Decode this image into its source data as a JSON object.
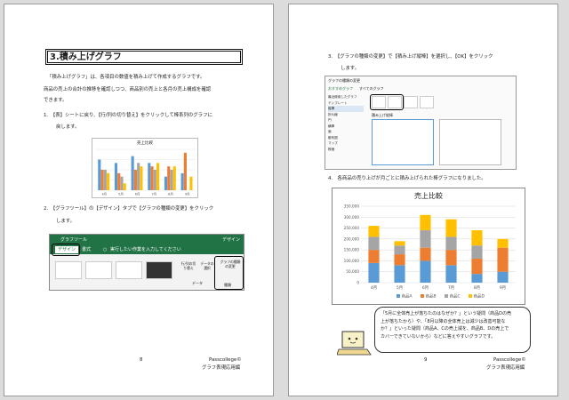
{
  "page_left": {
    "title": "3.積み上げグラフ",
    "intro1": "「積み上げグラフ」は、各項目の数値を積み上げて作成するグラフです。",
    "intro2": "商品の売上の合計の推移を確認しつつ、商品別の売上と各月の売上構成を確認",
    "intro3": "できます。",
    "step1_line1": "1.　【表】シートに戻り、【行/列の切り替え】をクリックして棒系列のグラフに",
    "step1_line2": "戻します。",
    "small_chart_title": "売上比較",
    "step2_line1": "2.　【グラフツール】の【デザイン】タブで【グラフの種類の変更】をクリック",
    "step2_line2": "します。",
    "ribbon": {
      "tools_label": "グラフツール",
      "design_label": "デザイン",
      "tab_design": "デザイン",
      "tab_format": "書式",
      "tell_me": "実行したい作業を入力してください",
      "switch_btn": "行/列の切り替え",
      "select_data_btn": "データの選択",
      "group_data": "データ",
      "change_type_btn": "グラフの種類の変更",
      "group_type": "種類"
    },
    "page_number": "8",
    "publisher": "Passcollege©",
    "book": "グラフ表現応用編"
  },
  "page_right": {
    "step3_line1": "3.　【グラフの種類の変更】で【積み上げ縦棒】を選択し、【OK】をクリック",
    "step3_line2": "します。",
    "dialog": {
      "title": "グラフの種類の変更",
      "tab_recommended": "おすすめグラフ",
      "tab_all": "すべてのグラフ",
      "left_items": [
        "最近使用したグラフ",
        "テンプレート",
        "縦棒",
        "折れ線",
        "円",
        "横棒",
        "面",
        "散布図",
        "マップ",
        "株価"
      ],
      "selected_heading": "積み上げ縦棒"
    },
    "step4_line1": "4.　各商品の売り上げが月ごとに積み上げられた棒グラフになりました。",
    "chart_data": {
      "type": "bar",
      "title": "売上比較",
      "categories": [
        "4月",
        "5月",
        "6月",
        "7月",
        "8月",
        "9月"
      ],
      "series": [
        {
          "name": "商品A",
          "color": "#5b9bd5",
          "values": [
            90000,
            80000,
            100000,
            80000,
            40000,
            50000
          ]
        },
        {
          "name": "商品B",
          "color": "#ed7d31",
          "values": [
            60000,
            50000,
            60000,
            70000,
            70000,
            110000
          ]
        },
        {
          "name": "商品C",
          "color": "#a5a5a5",
          "values": [
            60000,
            40000,
            80000,
            60000,
            60000,
            0
          ]
        },
        {
          "name": "商品D",
          "color": "#ffc000",
          "values": [
            50000,
            20000,
            70000,
            80000,
            70000,
            40000
          ]
        }
      ],
      "ylim": [
        0,
        350000
      ],
      "yticks": [
        "0",
        "50,000",
        "100,000",
        "150,000",
        "200,000",
        "250,000",
        "300,000",
        "350,000"
      ],
      "legend": "bottom",
      "grid": true
    },
    "bubble": {
      "line1": "「5月に全体売上が落ちたのはなぜか？」という疑問（商品Dの売",
      "line2": "上が落ちたから）や、「8月以降の全体売上は減少は改善可能な",
      "line3": "か？」といった疑問（商品A、Cの売上減を、商品B、Dの売上で",
      "line4": "カバーできていないから）などに答えやすいグラフです。"
    },
    "page_number": "9",
    "publisher": "Passcollege©",
    "book": "グラフ表現応用編"
  },
  "small_chart": {
    "categories": [
      "4月",
      "5月",
      "6月",
      "7月",
      "8月",
      "9月"
    ],
    "series": [
      {
        "color": "#5b9bd5",
        "values": [
          90000,
          80000,
          100000,
          80000,
          40000,
          50000
        ]
      },
      {
        "color": "#ed7d31",
        "values": [
          60000,
          50000,
          60000,
          70000,
          70000,
          110000
        ]
      },
      {
        "color": "#a5a5a5",
        "values": [
          60000,
          40000,
          80000,
          60000,
          60000,
          0
        ]
      },
      {
        "color": "#ffc000",
        "values": [
          50000,
          20000,
          70000,
          80000,
          70000,
          40000
        ]
      }
    ],
    "ymax": 120000
  }
}
